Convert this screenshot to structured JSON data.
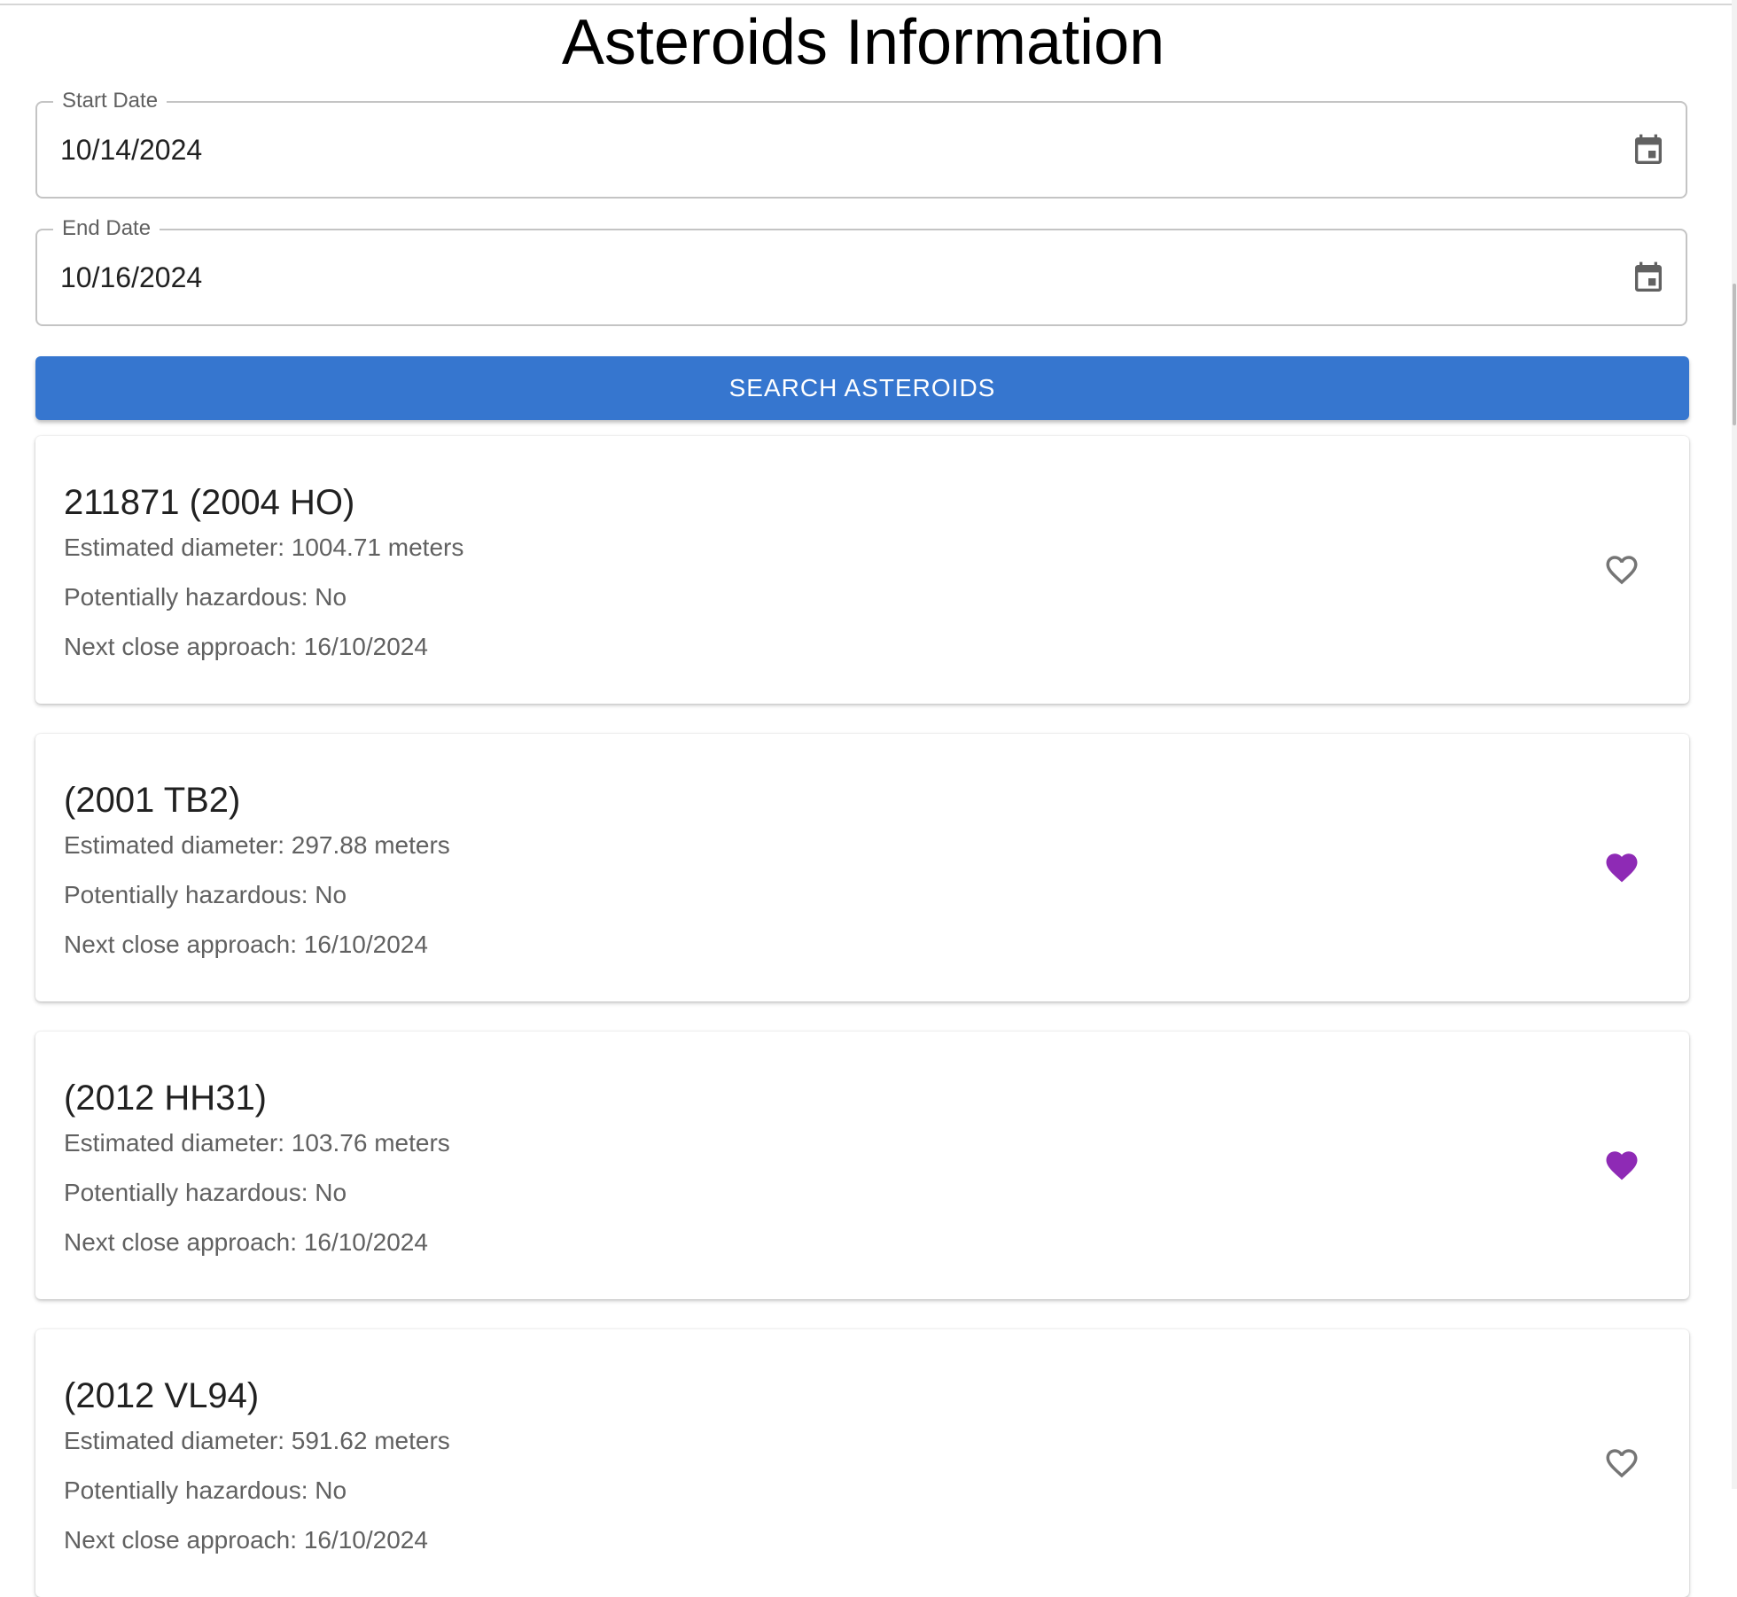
{
  "page": {
    "title": "Asteroids Information"
  },
  "form": {
    "start_date": {
      "label": "Start Date",
      "value": "10/14/2024",
      "icon": "calendar-icon"
    },
    "end_date": {
      "label": "End Date",
      "value": "10/16/2024",
      "icon": "calendar-icon"
    },
    "search_label": "SEARCH ASTEROIDS"
  },
  "colors": {
    "button": "#3676cf",
    "favorite_active": "#8e2ab5",
    "favorite_inactive": "#757575"
  },
  "asteroids": [
    {
      "name": "211871 (2004 HO)",
      "diameter": "Estimated diameter: 1004.71 meters",
      "hazardous": "Potentially hazardous: No",
      "approach": "Next close approach: 16/10/2024",
      "favorite": false
    },
    {
      "name": "(2001 TB2)",
      "diameter": "Estimated diameter: 297.88 meters",
      "hazardous": "Potentially hazardous: No",
      "approach": "Next close approach: 16/10/2024",
      "favorite": true
    },
    {
      "name": "(2012 HH31)",
      "diameter": "Estimated diameter: 103.76 meters",
      "hazardous": "Potentially hazardous: No",
      "approach": "Next close approach: 16/10/2024",
      "favorite": true
    },
    {
      "name": "(2012 VL94)",
      "diameter": "Estimated diameter: 591.62 meters",
      "hazardous": "Potentially hazardous: No",
      "approach": "Next close approach: 16/10/2024",
      "favorite": false
    }
  ]
}
